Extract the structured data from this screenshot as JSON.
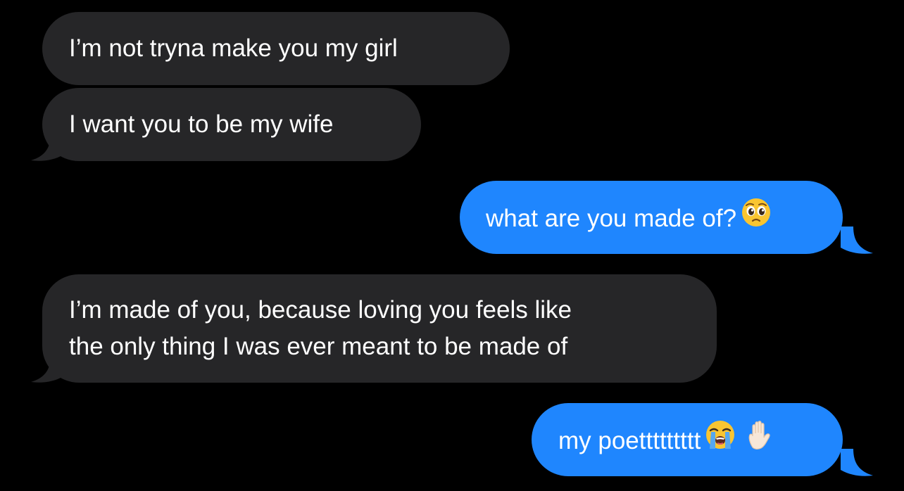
{
  "conversation": {
    "messages": [
      {
        "direction": "received",
        "text": "I’m not tryna make you my girl"
      },
      {
        "direction": "received",
        "text": "I want you to be my wife"
      },
      {
        "direction": "sent",
        "text": "what are you made of?",
        "emoji": [
          "pleading-face-emoji"
        ]
      },
      {
        "direction": "received",
        "lines": [
          "I’m made of you, because loving you feels like",
          "the only thing I was ever meant to be made of"
        ]
      },
      {
        "direction": "sent",
        "text": "my poettttttttt",
        "emoji": [
          "loudly-crying-face-emoji",
          "raised-hand-emoji"
        ]
      }
    ]
  },
  "colors": {
    "background": "#000000",
    "received_bubble": "#262628",
    "sent_bubble": "#1f86fe",
    "text": "#ffffff"
  }
}
